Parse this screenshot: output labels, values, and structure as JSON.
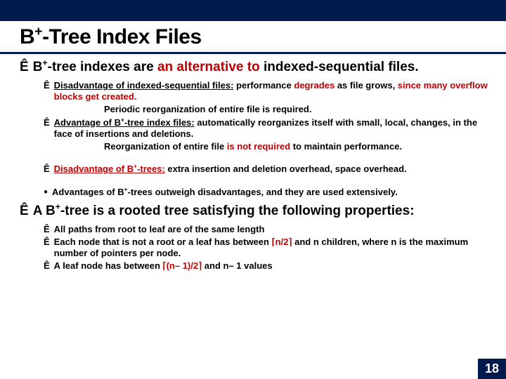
{
  "title_plain": "B",
  "title_sup": "+",
  "title_rest": "-Tree Index Files",
  "l1a_pre": "B",
  "l1a_sup": "+",
  "l1a_mid": "-tree indexes are ",
  "l1a_red": "an alternative to",
  "l1a_end": " indexed-sequential files.",
  "l2a_u": "Disadvantage of indexed-sequential files:",
  "l2a_mid1": " performance ",
  "l2a_red": "degrades",
  "l2a_mid2": " as file grows, ",
  "l2a_red2": "since many overflow blocks get created.",
  "l3a": "Periodic reorganization of entire file is required.",
  "l2b_u_pre": "Advantage of B",
  "l2b_u_sup": "+",
  "l2b_u_post": "-tree index files:",
  "l2b_txt": "  automatically reorganizes itself with small, local, changes, in the face of insertions and deletions.",
  "l3b_pre": "Reorganization of entire file ",
  "l3b_red": "is not required",
  "l3b_post": " to maintain performance.",
  "l2c_u_pre": "Disadvantage of B",
  "l2c_u_sup": "+",
  "l2c_u_post": "-trees:",
  "l2c_txt": " extra insertion and deletion overhead, space overhead.",
  "l2d_pre": "Advantages of B",
  "l2d_sup": "+",
  "l2d_post": "-trees outweigh disadvantages, and they are used extensively.",
  "l1b_pre": "A B",
  "l1b_sup": "+",
  "l1b_post": "-tree is a rooted tree satisfying the following properties:",
  "p1": "All paths from root to leaf are of the same length",
  "p2a": "Each node that is not a root or a leaf has between ",
  "p2r": "⌈n/2⌉",
  "p2b": " and n children, where n is the maximum number of pointers per node.",
  "p3a": "A leaf node has between ",
  "p3r": "⌈(n– 1)/2⌉",
  "p3b": " and n– 1 values",
  "arrow": "Ê",
  "circle": "●",
  "pagenum": "18"
}
